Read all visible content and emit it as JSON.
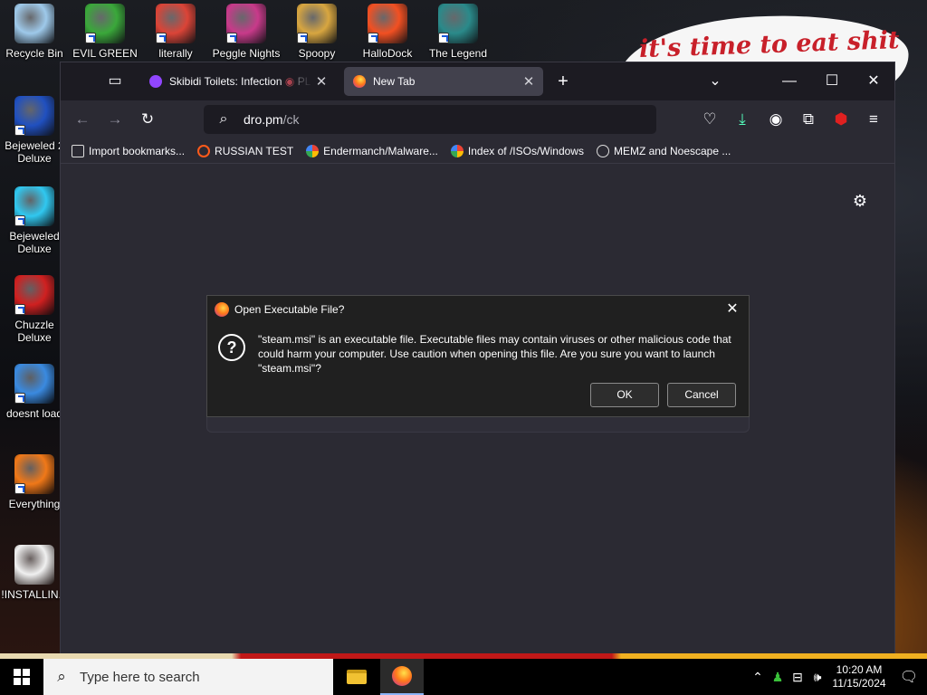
{
  "desktop": {
    "icons": [
      {
        "label": "Recycle Bin",
        "icon": "recycle-bin-icon",
        "color": "#9ec9ea"
      },
      {
        "label": "EVIL GREEN",
        "icon": "messenger-people-icon",
        "color": "#3aa83a"
      },
      {
        "label": "literally",
        "icon": "chrome-icon",
        "color": "#db4437"
      },
      {
        "label": "Peggle Nights",
        "icon": "peggle-icon",
        "color": "#c83a8a"
      },
      {
        "label": "Spoopy",
        "icon": "spoopy-icon",
        "color": "#d8a640"
      },
      {
        "label": "HalloDock",
        "icon": "windows-logo-icon",
        "color": "#f25022"
      },
      {
        "label": "The Legend",
        "icon": "character-icon",
        "color": "#2a8a8a"
      },
      {
        "label": "Bejeweled 2 Deluxe",
        "icon": "bejeweled2-icon",
        "color": "#2050c0"
      },
      {
        "label": "Bejeweled Deluxe",
        "icon": "diamond-icon",
        "color": "#30c8f0"
      },
      {
        "label": "Chuzzle Deluxe",
        "icon": "chuzzle-icon",
        "color": "#d02020"
      },
      {
        "label": "doesnt load",
        "icon": "thunderbird-icon",
        "color": "#3a8ae0"
      },
      {
        "label": "Everything",
        "icon": "everything-search-icon",
        "color": "#f07818"
      },
      {
        "label": "!INSTALLIN...",
        "icon": "text-file-icon",
        "color": "#f0f0f0"
      }
    ],
    "meme_text": "it's time to eat shit"
  },
  "browser": {
    "tabs": [
      {
        "title": "Skibidi Toilets: Infection",
        "title_extra": "PL",
        "icon": "twitch-icon",
        "color": "#9146ff"
      },
      {
        "title": "New Tab",
        "icon": "firefox-icon",
        "color": "#ff7a1a"
      }
    ],
    "url_host": "dro.pm",
    "url_path": "/ck",
    "bookmarks": [
      {
        "label": "Import bookmarks...",
        "icon": "import-icon",
        "color": "#dddddd"
      },
      {
        "label": "RUSSIAN TEST",
        "icon": "russian-test-icon",
        "color": "#ff5a1a"
      },
      {
        "label": "Endermanch/Malware...",
        "icon": "google-icon",
        "color": "#4285f4"
      },
      {
        "label": "Index of /ISOs/Windows",
        "icon": "google-icon",
        "color": "#4285f4"
      },
      {
        "label": "MEMZ and Noescape ...",
        "icon": "globe-icon",
        "color": "#dddddd"
      }
    ]
  },
  "dialog": {
    "title": "Open Executable File?",
    "message": "\"steam.msi\" is an executable file. Executable files may contain viruses or other malicious code that could harm your computer. Use caution when opening this file. Are you sure you want to launch \"steam.msi\"?",
    "ok_label": "OK",
    "cancel_label": "Cancel"
  },
  "taskbar": {
    "search_placeholder": "Type here to search",
    "time": "10:20 AM",
    "date": "11/15/2024"
  }
}
